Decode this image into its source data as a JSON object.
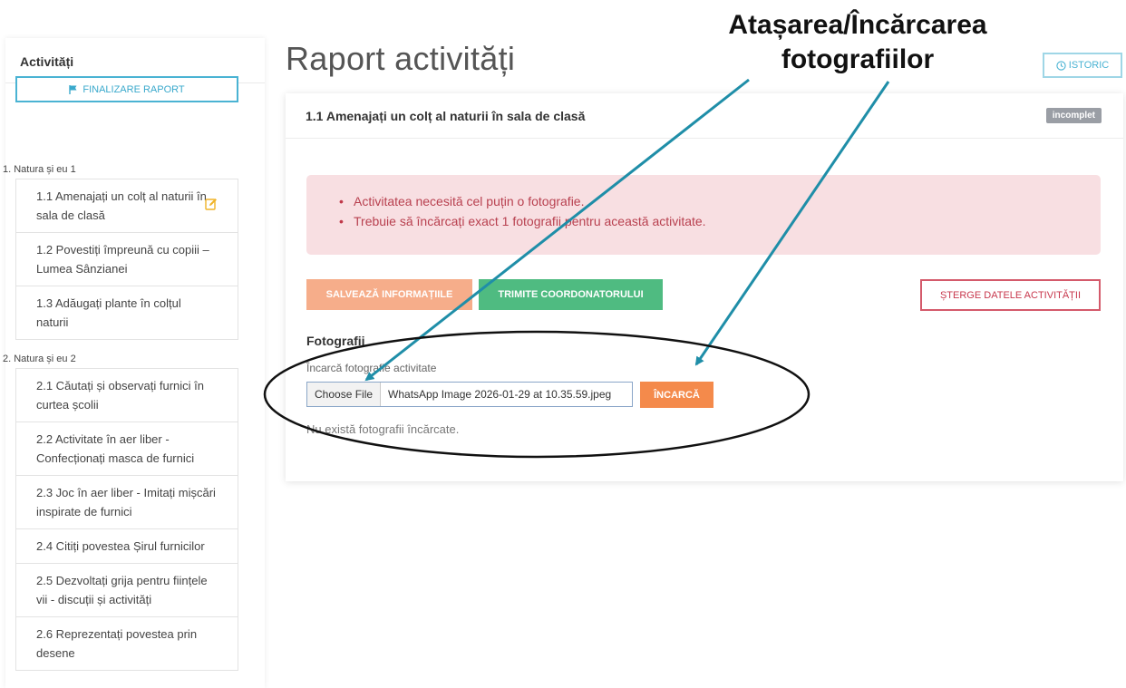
{
  "sidebar": {
    "title": "Activități",
    "finalize_label": "FINALIZARE RAPORT",
    "groups": [
      {
        "label": "1. Natura și eu 1",
        "items": [
          {
            "label": "1.1 Amenajați un colț al naturii în sala de clasă"
          },
          {
            "label": "1.2 Povestiți împreună cu copiii – Lumea Sânzianei"
          },
          {
            "label": "1.3 Adăugați plante în colțul naturii"
          }
        ]
      },
      {
        "label": "2. Natura și eu 2",
        "items": [
          {
            "label": "2.1 Căutați și observați furnici în curtea școlii"
          },
          {
            "label": "2.2 Activitate în aer liber - Confecționați masca de furnici"
          },
          {
            "label": "2.3 Joc în aer liber - Imitați mișcări inspirate de furnici"
          },
          {
            "label": "2.4 Citiți povestea Șirul furnicilor"
          },
          {
            "label": "2.5 Dezvoltați grija pentru ființele vii - discuții și activități"
          },
          {
            "label": "2.6 Reprezentați povestea prin desene"
          }
        ]
      }
    ]
  },
  "main": {
    "title": "Raport activități",
    "history_label": "ISTORIC",
    "card": {
      "title": "1.1 Amenajați un colț al naturii în sala de clasă",
      "status": "incomplet",
      "errors": [
        "Activitatea necesită cel puțin o fotografie.",
        "Trebuie să încărcați exact 1 fotografii pentru această activitate."
      ],
      "save_label": "SALVEAZĂ INFORMAȚIILE",
      "send_label": "TRIMITE COORDONATORULUI",
      "delete_label": "ȘTERGE DATELE ACTIVITĂȚII",
      "photos_title": "Fotografii",
      "upload_label": "Încarcă fotografie activitate",
      "choose_file_label": "Choose File",
      "file_name": "WhatsApp Image 2026-01-29 at 10.35.59.jpeg",
      "upload_button_label": "ÎNCARCĂ",
      "empty_message": "Nu există fotografii încărcate."
    }
  },
  "annotation": {
    "line1": "Atașarea/Încărcarea",
    "line2": "fotografiilor"
  },
  "colors": {
    "accent": "#4ab3d3",
    "arrow": "#1f8ea8",
    "alert_bg": "#f8dfe2",
    "alert_text": "#b8404f",
    "save": "#f6ad8a",
    "send": "#4fbb81",
    "upload": "#f48a4b",
    "badge": "#9a9ea5"
  }
}
